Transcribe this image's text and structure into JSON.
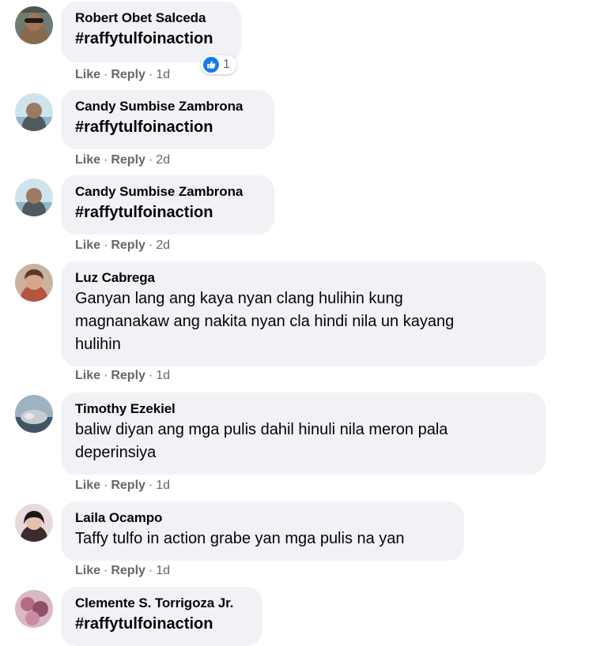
{
  "comments": [
    {
      "author": "Robert Obet Salceda",
      "text": "#raffytulfoinaction",
      "like": "Like",
      "reply": "Reply",
      "time": "1d",
      "reactions": {
        "icon": "like-icon",
        "count": "1"
      }
    },
    {
      "author": "Candy Sumbise Zambrona",
      "text": "#raffytulfoinaction",
      "like": "Like",
      "reply": "Reply",
      "time": "2d"
    },
    {
      "author": "Candy Sumbise Zambrona",
      "text": "#raffytulfoinaction",
      "like": "Like",
      "reply": "Reply",
      "time": "2d"
    },
    {
      "author": "Luz Cabrega",
      "text_lines": [
        "Ganyan lang ang kaya nyan clang hulihin kung",
        "magnanakaw ang nakita nyan cla hindi nila un kayang",
        "hulihin"
      ],
      "like": "Like",
      "reply": "Reply",
      "time": "1d"
    },
    {
      "author": "Timothy Ezekiel",
      "text_lines": [
        "baliw diyan ang mga pulis dahil hinuli nila meron pala",
        "deperinsiya"
      ],
      "like": "Like",
      "reply": "Reply",
      "time": "1d"
    },
    {
      "author": "Laila Ocampo",
      "text": "Taffy tulfo in action grabe yan mga pulis na yan",
      "like": "Like",
      "reply": "Reply",
      "time": "1d"
    },
    {
      "author": "Clemente S. Torrigoza Jr.",
      "text": "#raffytulfoinaction"
    }
  ],
  "separator": "·",
  "colors": {
    "bubble_bg": "#f0f2f5",
    "meta_text": "#65676b",
    "like_blue": "#1877f2"
  }
}
